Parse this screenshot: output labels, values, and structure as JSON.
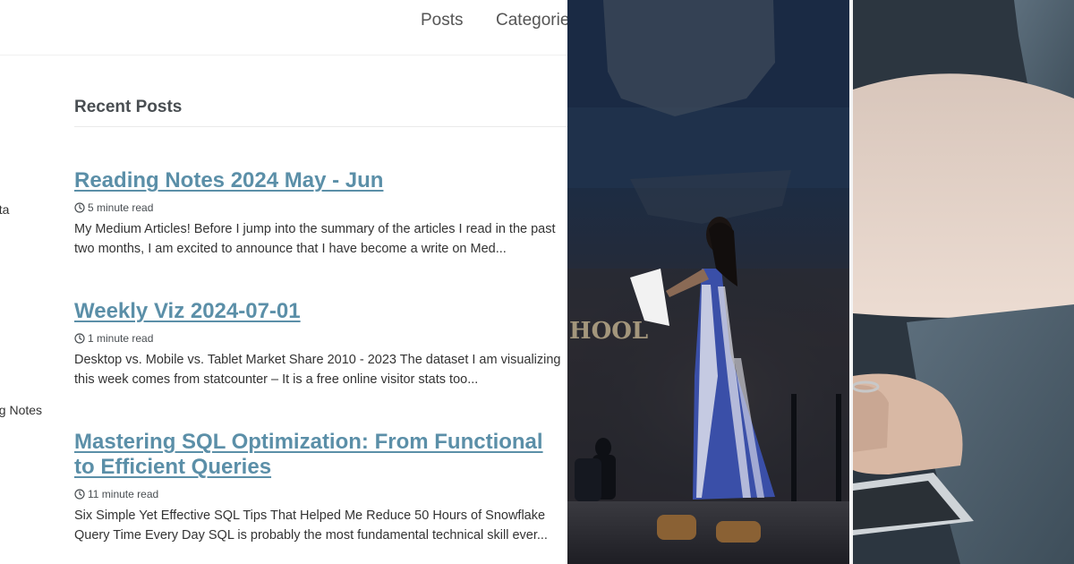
{
  "nav": {
    "posts_label": "Posts",
    "categories_label": "Categorie"
  },
  "sidebar": {
    "items": [
      "ata",
      "ng Notes"
    ]
  },
  "section": {
    "title": "Recent Posts"
  },
  "posts": [
    {
      "title": "Reading Notes 2024 May - Jun",
      "read_time": "5 minute read",
      "excerpt": "My Medium Articles! Before I jump into the summary of the articles I read in the past two months, I am excited to announce that I have become a write on Med..."
    },
    {
      "title": "Weekly Viz 2024-07-01",
      "read_time": "1 minute read",
      "excerpt": "Desktop vs. Mobile vs. Tablet Market Share 2010 - 2023 The dataset I am visualizing this week comes from statcounter – It is a free online visitor stats too..."
    },
    {
      "title": "Mastering SQL Optimization: From Functional to Efficient Queries",
      "read_time": "11 minute read",
      "excerpt": "Six Simple Yet Effective SQL Tips That Helped Me Reduce 50 Hours of Snowflake Query Time Every Day SQL is probably the most fundamental technical skill ever..."
    }
  ],
  "photo_stage": {
    "sign_text": "HOOL"
  },
  "colors": {
    "link": "#5b8fa8",
    "text": "#333333",
    "heading": "#494e52"
  }
}
